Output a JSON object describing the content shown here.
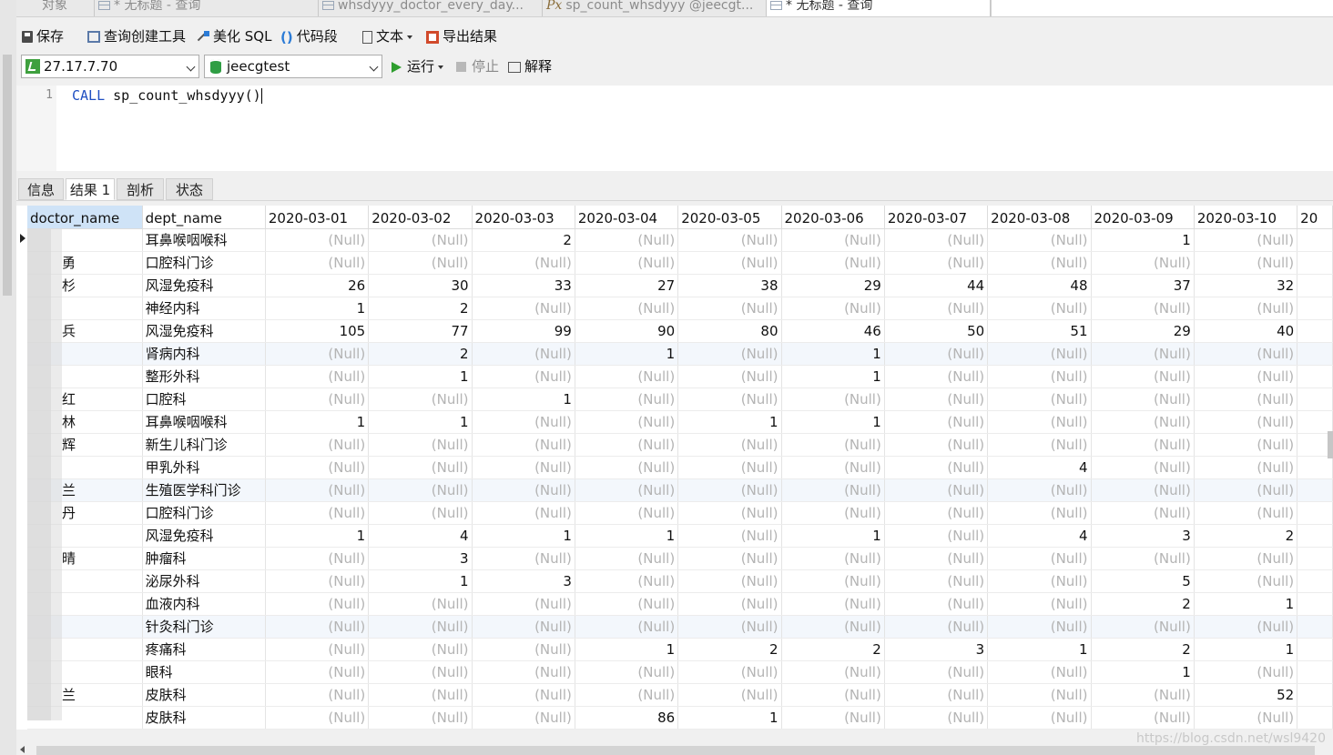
{
  "tabs": [
    {
      "label": "对象",
      "icon": "none"
    },
    {
      "label": "* 无标题 - 查询",
      "icon": "table-icon"
    },
    {
      "label": "whsdyyy_doctor_every_day...",
      "icon": "query-icon"
    },
    {
      "label": "sp_count_whsdyyy @jeecgt...",
      "icon": "procedure-icon",
      "prefix": "Px"
    },
    {
      "label": "* 无标题 - 查询",
      "icon": "table-icon",
      "active": true
    }
  ],
  "toolbar": {
    "save": "保存",
    "builder": "查询创建工具",
    "beautify": "美化 SQL",
    "code_icon": "()",
    "snippet": "代码段",
    "text": "文本",
    "export": "导出结果"
  },
  "connection": {
    "value": "27.17.7.70"
  },
  "database": {
    "value": "jeecgtest"
  },
  "run": {
    "run": "运行",
    "stop": "停止",
    "explain": "解释"
  },
  "editor": {
    "line": "1",
    "keyword": "CALL",
    "rest": " sp_count_whsdyyy()"
  },
  "result_tabs": [
    "信息",
    "结果 1",
    "剖析",
    "状态"
  ],
  "grid": {
    "columns": [
      "doctor_name",
      "dept_name",
      "2020-03-01",
      "2020-03-02",
      "2020-03-03",
      "2020-03-04",
      "2020-03-05",
      "2020-03-06",
      "2020-03-07",
      "2020-03-08",
      "2020-03-09",
      "2020-03-10",
      "20"
    ],
    "rows": [
      {
        "doc": "",
        "dept": "耳鼻喉咽喉科",
        "v": [
          "(Null)",
          "(Null)",
          "2",
          "(Null)",
          "(Null)",
          "(Null)",
          "(Null)",
          "(Null)",
          "1",
          "(Null)"
        ]
      },
      {
        "doc": "勇",
        "dept": "口腔科门诊",
        "v": [
          "(Null)",
          "(Null)",
          "(Null)",
          "(Null)",
          "(Null)",
          "(Null)",
          "(Null)",
          "(Null)",
          "(Null)",
          "(Null)"
        ]
      },
      {
        "doc": "杉",
        "dept": "风湿免疫科",
        "v": [
          "26",
          "30",
          "33",
          "27",
          "38",
          "29",
          "44",
          "48",
          "37",
          "32"
        ]
      },
      {
        "doc": "",
        "dept": "神经内科",
        "v": [
          "1",
          "2",
          "(Null)",
          "(Null)",
          "(Null)",
          "(Null)",
          "(Null)",
          "(Null)",
          "(Null)",
          "(Null)"
        ]
      },
      {
        "doc": "兵",
        "dept": "风湿免疫科",
        "v": [
          "105",
          "77",
          "99",
          "90",
          "80",
          "46",
          "50",
          "51",
          "29",
          "40"
        ]
      },
      {
        "doc": "",
        "dept": "肾病内科",
        "v": [
          "(Null)",
          "2",
          "(Null)",
          "1",
          "(Null)",
          "1",
          "(Null)",
          "(Null)",
          "(Null)",
          "(Null)"
        ]
      },
      {
        "doc": "",
        "dept": "整形外科",
        "v": [
          "(Null)",
          "1",
          "(Null)",
          "(Null)",
          "(Null)",
          "1",
          "(Null)",
          "(Null)",
          "(Null)",
          "(Null)"
        ]
      },
      {
        "doc": "红",
        "dept": "口腔科",
        "v": [
          "(Null)",
          "(Null)",
          "1",
          "(Null)",
          "(Null)",
          "(Null)",
          "(Null)",
          "(Null)",
          "(Null)",
          "(Null)"
        ]
      },
      {
        "doc": "林",
        "dept": "耳鼻喉咽喉科",
        "v": [
          "1",
          "1",
          "(Null)",
          "(Null)",
          "1",
          "1",
          "(Null)",
          "(Null)",
          "(Null)",
          "(Null)"
        ]
      },
      {
        "doc": "辉",
        "dept": "新生儿科门诊",
        "v": [
          "(Null)",
          "(Null)",
          "(Null)",
          "(Null)",
          "(Null)",
          "(Null)",
          "(Null)",
          "(Null)",
          "(Null)",
          "(Null)"
        ]
      },
      {
        "doc": "",
        "dept": "甲乳外科",
        "v": [
          "(Null)",
          "(Null)",
          "(Null)",
          "(Null)",
          "(Null)",
          "(Null)",
          "(Null)",
          "4",
          "(Null)",
          "(Null)"
        ]
      },
      {
        "doc": "兰",
        "dept": "生殖医学科门诊",
        "v": [
          "(Null)",
          "(Null)",
          "(Null)",
          "(Null)",
          "(Null)",
          "(Null)",
          "(Null)",
          "(Null)",
          "(Null)",
          "(Null)"
        ]
      },
      {
        "doc": "丹",
        "dept": "口腔科门诊",
        "v": [
          "(Null)",
          "(Null)",
          "(Null)",
          "(Null)",
          "(Null)",
          "(Null)",
          "(Null)",
          "(Null)",
          "(Null)",
          "(Null)"
        ]
      },
      {
        "doc": "",
        "dept": "风湿免疫科",
        "v": [
          "1",
          "4",
          "1",
          "1",
          "(Null)",
          "1",
          "(Null)",
          "4",
          "3",
          "2"
        ]
      },
      {
        "doc": "晴",
        "dept": "肿瘤科",
        "v": [
          "(Null)",
          "3",
          "(Null)",
          "(Null)",
          "(Null)",
          "(Null)",
          "(Null)",
          "(Null)",
          "(Null)",
          "(Null)"
        ]
      },
      {
        "doc": "",
        "dept": "泌尿外科",
        "v": [
          "(Null)",
          "1",
          "3",
          "(Null)",
          "(Null)",
          "(Null)",
          "(Null)",
          "(Null)",
          "5",
          "(Null)"
        ]
      },
      {
        "doc": "",
        "dept": "血液内科",
        "v": [
          "(Null)",
          "(Null)",
          "(Null)",
          "(Null)",
          "(Null)",
          "(Null)",
          "(Null)",
          "(Null)",
          "2",
          "1"
        ]
      },
      {
        "doc": "",
        "dept": "针灸科门诊",
        "v": [
          "(Null)",
          "(Null)",
          "(Null)",
          "(Null)",
          "(Null)",
          "(Null)",
          "(Null)",
          "(Null)",
          "(Null)",
          "(Null)"
        ]
      },
      {
        "doc": "",
        "dept": "疼痛科",
        "v": [
          "(Null)",
          "(Null)",
          "(Null)",
          "1",
          "2",
          "2",
          "3",
          "1",
          "2",
          "1"
        ]
      },
      {
        "doc": "",
        "dept": "眼科",
        "v": [
          "(Null)",
          "(Null)",
          "(Null)",
          "(Null)",
          "(Null)",
          "(Null)",
          "(Null)",
          "(Null)",
          "1",
          "(Null)"
        ]
      },
      {
        "doc": "兰",
        "dept": "皮肤科",
        "v": [
          "(Null)",
          "(Null)",
          "(Null)",
          "(Null)",
          "(Null)",
          "(Null)",
          "(Null)",
          "(Null)",
          "(Null)",
          "52"
        ]
      },
      {
        "doc": "",
        "dept": "皮肤科",
        "v": [
          "(Null)",
          "(Null)",
          "(Null)",
          "86",
          "1",
          "(Null)",
          "(Null)",
          "(Null)",
          "(Null)",
          "(Null)"
        ]
      }
    ]
  },
  "watermark": "https://blog.csdn.net/wsl9420"
}
